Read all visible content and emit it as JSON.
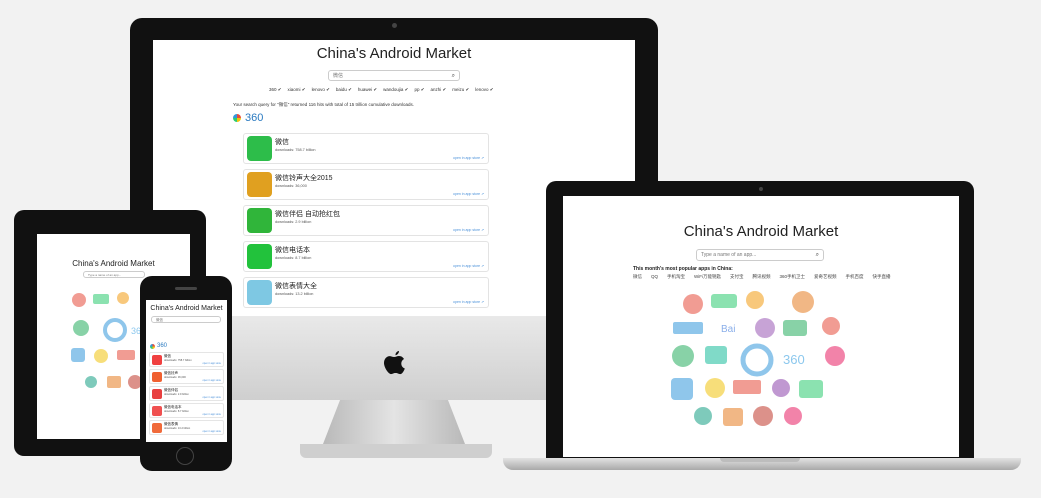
{
  "site": {
    "title": "China's Android Market"
  },
  "imac": {
    "search_value": "微信",
    "stores": [
      "360",
      "xiaomi",
      "lenovo",
      "baidu",
      "huawei",
      "wandoujia",
      "pp",
      "anzhi",
      "meizu",
      "lenovo"
    ],
    "summary": "Your search query for \"微信\" returned 116 hits with total of 15 trillion cumulative downloads.",
    "store_header": "360",
    "apps": [
      {
        "name": "微信",
        "downloads": "downloads: 758.7 billion",
        "link": "open in app store",
        "color": "#2dbd4a"
      },
      {
        "name": "微信铃声大全2015",
        "downloads": "downloads: 36,000",
        "link": "open in app store",
        "color": "#e0a020"
      },
      {
        "name": "微信伴侣 自动抢红包",
        "downloads": "downloads: 2.9 billion",
        "link": "open in app store",
        "color": "#30b53a"
      },
      {
        "name": "微信电话本",
        "downloads": "downloads: 8.7 billion",
        "link": "open in app store",
        "color": "#22c23c"
      },
      {
        "name": "微信表情大全",
        "downloads": "downloads: 13.2 billion",
        "link": "open in app store",
        "color": "#7ec8e3"
      }
    ]
  },
  "laptop": {
    "search_placeholder": "Type a name of an app...",
    "popular_label": "This month's most popular apps in China:",
    "categories": [
      "微信",
      "QQ",
      "手机淘宝",
      "WiFi万能钥匙",
      "支付宝",
      "腾讯视频",
      "360手机卫士",
      "爱奇艺视频",
      "手机百度",
      "快手直播"
    ]
  },
  "tablet": {
    "search_placeholder": "Type a name of an app..."
  },
  "phone": {
    "search_value": "微信",
    "store_header": "360",
    "apps": [
      {
        "name": "微信",
        "downloads": "downloads: 758.7 billion",
        "link": "open in app store",
        "color": "#f04040"
      },
      {
        "name": "微信铃声",
        "downloads": "downloads: 36,000",
        "link": "open in app store",
        "color": "#f06030"
      },
      {
        "name": "微信伴侣",
        "downloads": "downloads: 2.9 billion",
        "link": "open in app store",
        "color": "#e84040"
      },
      {
        "name": "微信电话本",
        "downloads": "downloads: 8.7 billion",
        "link": "open in app store",
        "color": "#f05050"
      },
      {
        "name": "微信表情",
        "downloads": "downloads: 13.2 billion",
        "link": "open in app store",
        "color": "#f06a3a"
      }
    ]
  }
}
